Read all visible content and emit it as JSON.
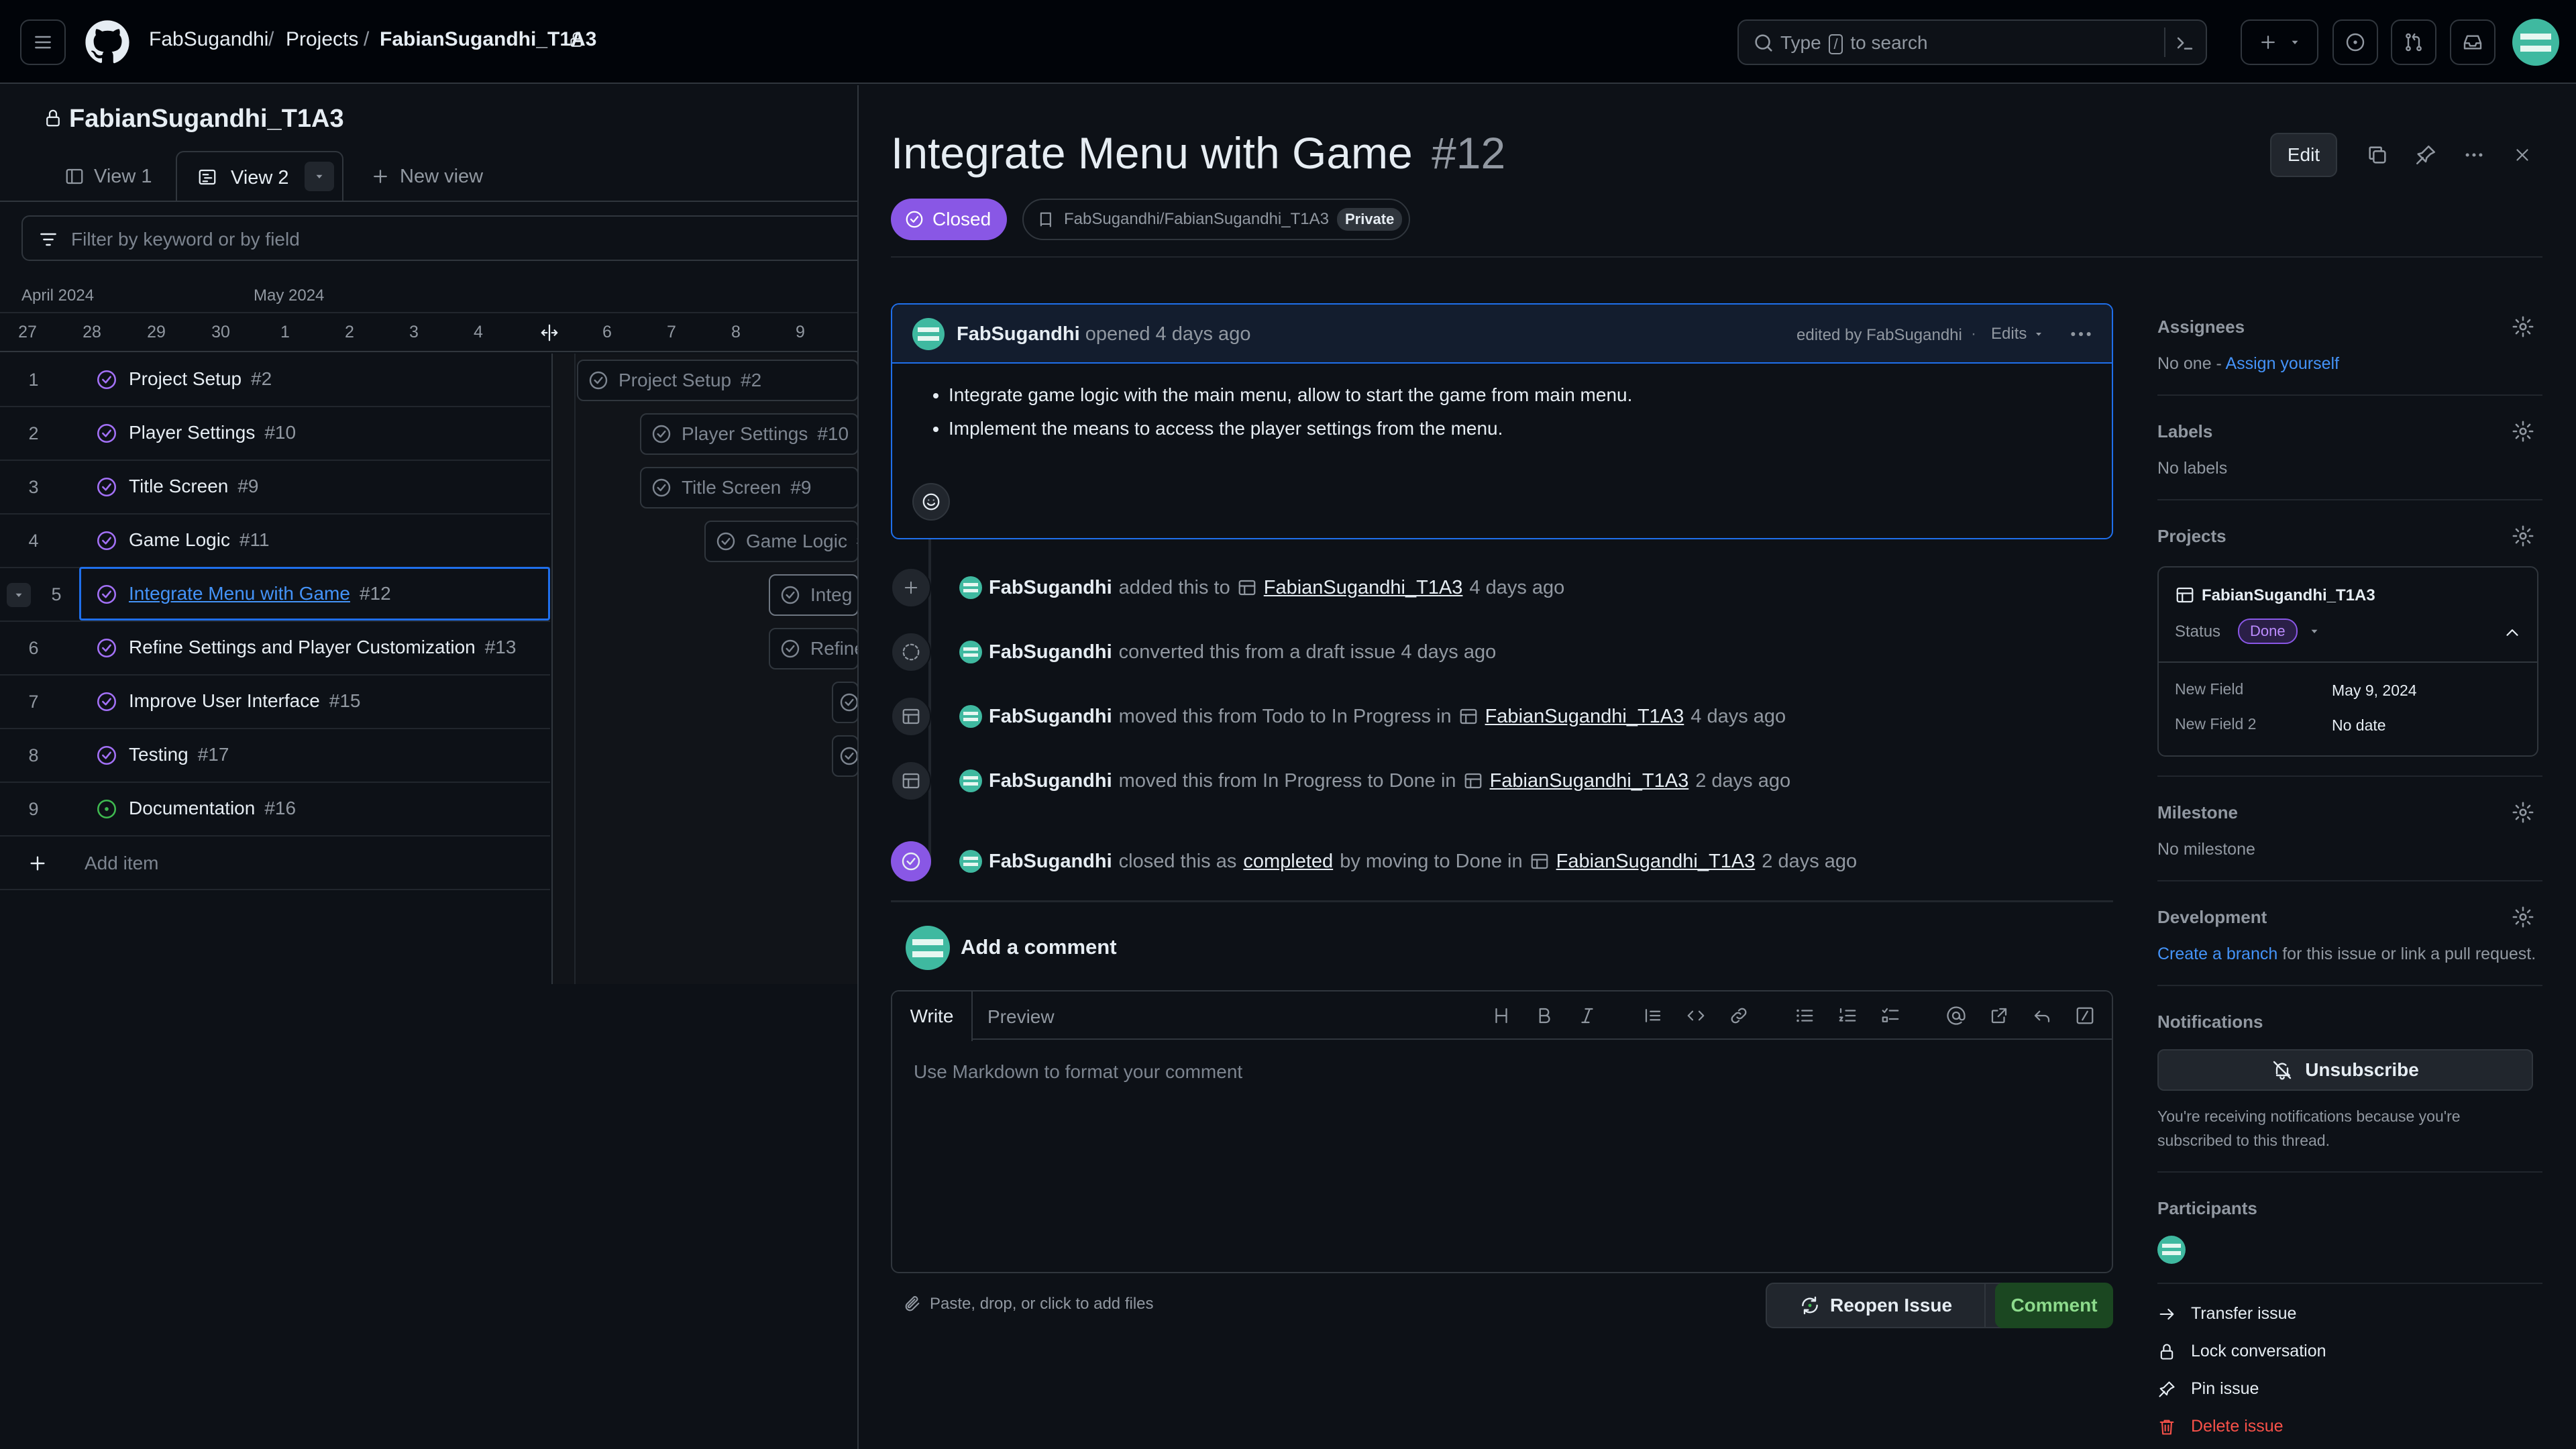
{
  "header": {
    "breadcrumb": [
      "FabSugandhi",
      "Projects",
      "FabianSugandhi_T1A3"
    ],
    "search_placeholder": "Type / to search",
    "search_key": "/",
    "search_before": "Type",
    "search_after": "to search"
  },
  "project": {
    "title": "FabianSugandhi_T1A3",
    "views": [
      "View 1",
      "View 2"
    ],
    "new_view": "New view",
    "filter_placeholder": "Filter by keyword or by field",
    "months": [
      "April 2024",
      "May 2024"
    ],
    "days": [
      "27",
      "28",
      "29",
      "30",
      "1",
      "2",
      "3",
      "4",
      "6",
      "7",
      "8",
      "9"
    ],
    "rows": [
      {
        "n": "1",
        "title": "Project Setup",
        "num": "#2"
      },
      {
        "n": "2",
        "title": "Player Settings",
        "num": "#10"
      },
      {
        "n": "3",
        "title": "Title Screen",
        "num": "#9"
      },
      {
        "n": "4",
        "title": "Game Logic",
        "num": "#11"
      },
      {
        "n": "5",
        "title": "Integrate Menu with Game",
        "num": "#12"
      },
      {
        "n": "6",
        "title": "Refine Settings and Player Customization",
        "num": "#13"
      },
      {
        "n": "7",
        "title": "Improve User Interface",
        "num": "#15"
      },
      {
        "n": "8",
        "title": "Testing",
        "num": "#17"
      },
      {
        "n": "9",
        "title": "Documentation",
        "num": "#16"
      }
    ],
    "add_item": "Add item",
    "bars": [
      {
        "label": "Project Setup",
        "num": "#2"
      },
      {
        "label": "Player Settings",
        "num": "#10"
      },
      {
        "label": "Title Screen",
        "num": "#9"
      },
      {
        "label": "Game Logic",
        "num": "#"
      },
      {
        "label": "Integ",
        "num": ""
      },
      {
        "label": "Refine",
        "num": ""
      }
    ]
  },
  "issue": {
    "title": "Integrate Menu with Game",
    "number": "#12",
    "state": "Closed",
    "repo": "FabSugandhi/FabianSugandhi_T1A3",
    "visibility": "Private",
    "edit_label": "Edit",
    "author": "FabSugandhi",
    "opened": "opened 4 days ago",
    "edited_by": "edited by FabSugandhi",
    "edits_label": "Edits",
    "body": [
      "Integrate game logic with the main menu, allow to start the game from main menu.",
      "Implement the means to access the player settings from the menu."
    ],
    "timeline": [
      {
        "pre": "added this to",
        "link": "FabianSugandhi_T1A3",
        "post": "4 days ago"
      },
      {
        "pre": "converted this from a draft issue 4 days ago",
        "link": "",
        "post": ""
      },
      {
        "pre": "moved this from Todo to In Progress in",
        "link": "FabianSugandhi_T1A3",
        "post": "4 days ago"
      },
      {
        "pre": "moved this from In Progress to Done in",
        "link": "FabianSugandhi_T1A3",
        "post": "2 days ago"
      },
      {
        "pre": "closed this as",
        "link1": "completed",
        "mid": "by moving to Done in",
        "link": "FabianSugandhi_T1A3",
        "post": "2 days ago"
      }
    ],
    "comment": {
      "heading": "Add a comment",
      "tabs": [
        "Write",
        "Preview"
      ],
      "placeholder": "Use Markdown to format your comment",
      "attach_hint": "Paste, drop, or click to add files",
      "reopen_label": "Reopen Issue",
      "comment_label": "Comment"
    }
  },
  "sidebar": {
    "assignees_title": "Assignees",
    "assignees_none": "No one - ",
    "assign_yourself": "Assign yourself",
    "labels_title": "Labels",
    "labels_value": "No labels",
    "projects_title": "Projects",
    "project_name": "FabianSugandhi_T1A3",
    "status_label": "Status",
    "status_value": "Done",
    "fields": [
      {
        "name": "New Field",
        "value": "May 9, 2024"
      },
      {
        "name": "New Field 2",
        "value": "No date"
      }
    ],
    "milestone_title": "Milestone",
    "milestone_value": "No milestone",
    "development_title": "Development",
    "create_branch": "Create a branch",
    "development_rest": " for this issue or link a pull request.",
    "notifications_title": "Notifications",
    "unsubscribe": "Unsubscribe",
    "notifications_reason": "You're receiving notifications because you're subscribed to this thread.",
    "participants_title": "Participants",
    "actions": [
      "Transfer issue",
      "Lock conversation",
      "Pin issue",
      "Delete issue"
    ]
  },
  "colors": {
    "accent_purple": "#8957e5",
    "done_purple": "#a371f7",
    "open_green": "#3fb950",
    "link_blue": "#4493f8",
    "danger": "#f85149",
    "comment_green": "#238636"
  }
}
